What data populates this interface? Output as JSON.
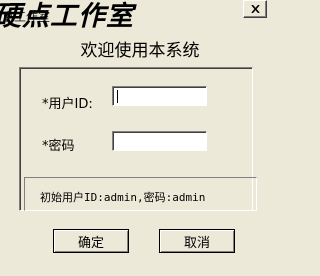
{
  "window": {
    "title_partial": "硬点工作室",
    "brand": "硬点工作室",
    "close_glyph": "✕"
  },
  "dialog": {
    "heading": "欢迎使用本系统",
    "user_id_label": "*用户ID:",
    "user_id_value": "",
    "password_label": "*密码",
    "password_value": "",
    "hint": "初始用户ID:admin,密码:admin",
    "ok_label": "确定",
    "cancel_label": "取消"
  }
}
